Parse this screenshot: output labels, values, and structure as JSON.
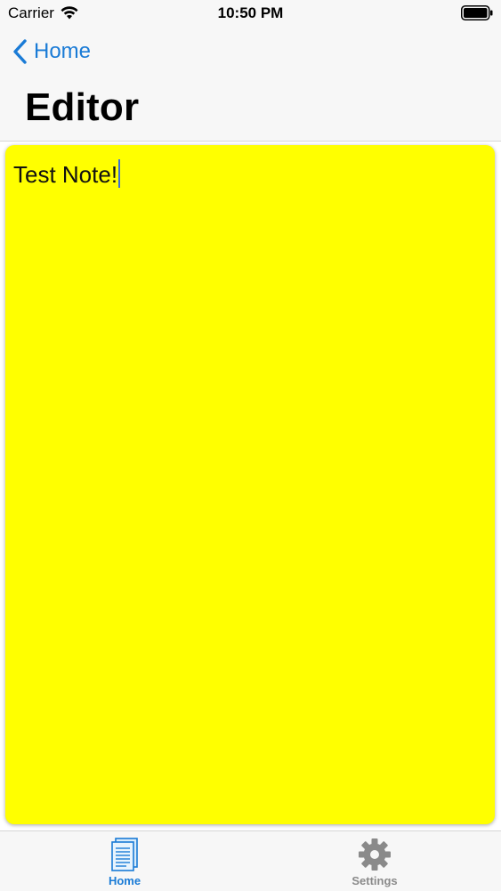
{
  "status_bar": {
    "carrier": "Carrier",
    "time": "10:50 PM",
    "icons": [
      "wifi-icon",
      "battery-icon"
    ]
  },
  "nav": {
    "back_label": "Home",
    "back_icon": "chevron-left-icon",
    "title": "Editor",
    "accent_color": "#1a7bd6"
  },
  "editor": {
    "text": "Test Note!",
    "background_color": "#ffff00"
  },
  "tab_bar": {
    "tabs": [
      {
        "label": "Home",
        "icon": "document-icon",
        "selected": true
      },
      {
        "label": "Settings",
        "icon": "gear-icon",
        "selected": false
      }
    ]
  }
}
